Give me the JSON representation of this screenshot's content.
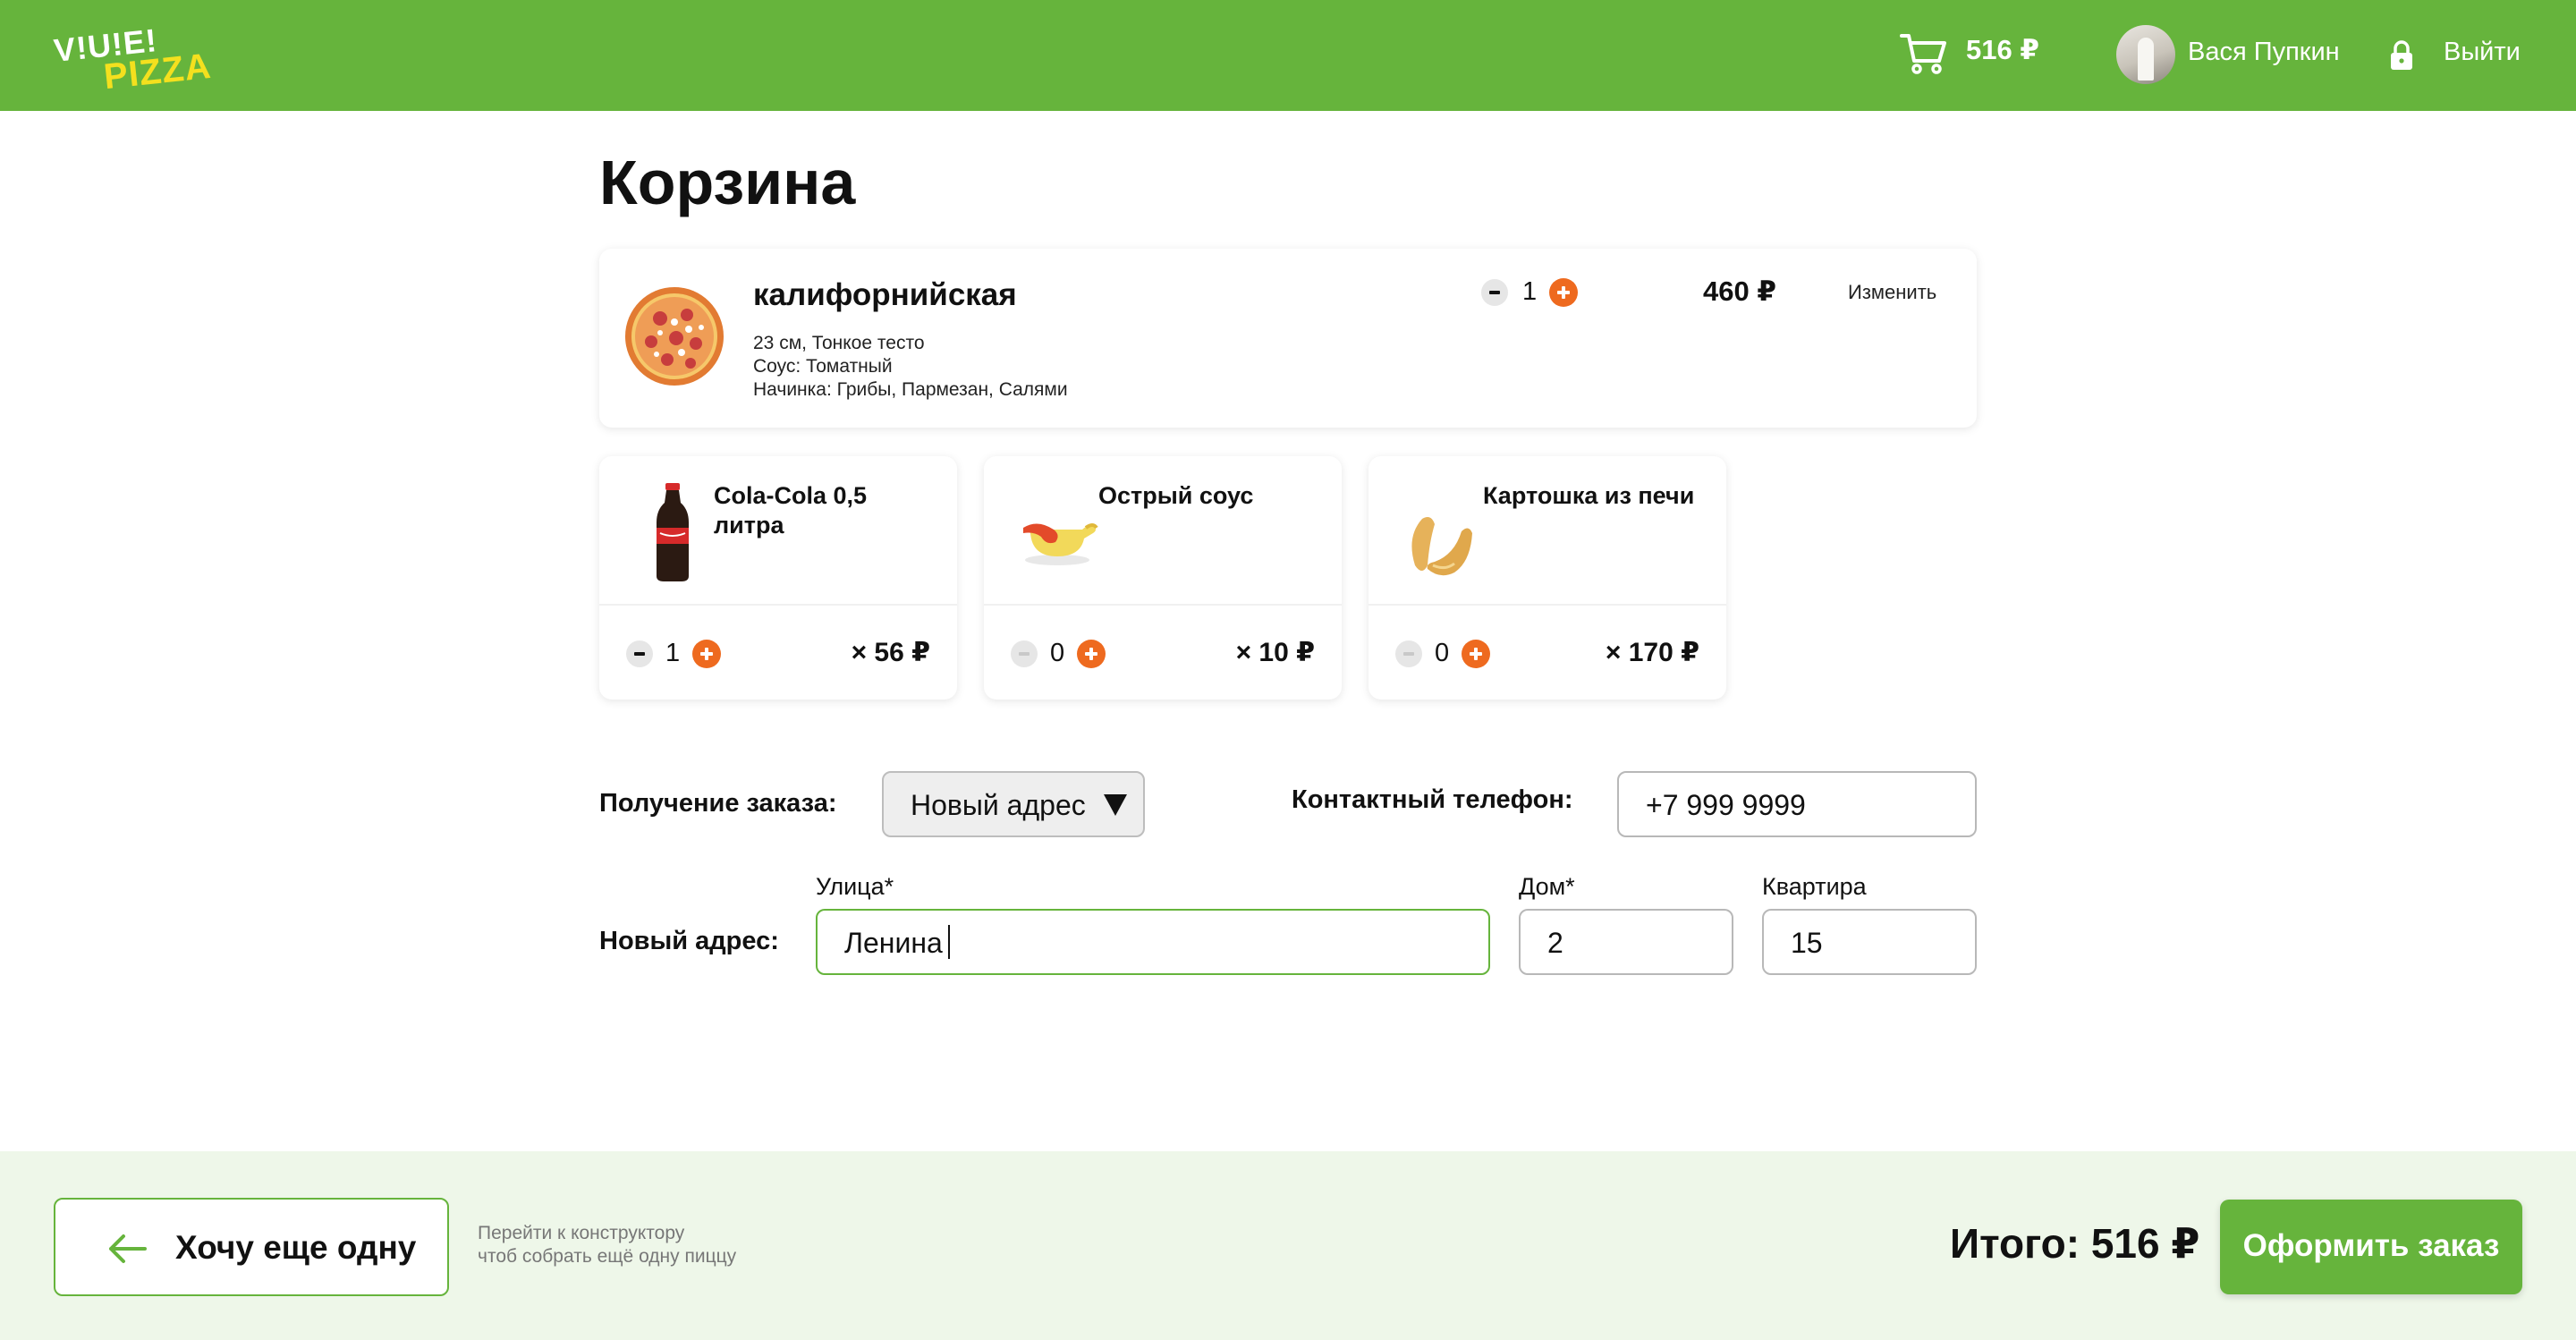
{
  "header": {
    "logo_top": "V!U!E!",
    "logo_bottom": "PIZZA",
    "cart_sum": "516 ₽",
    "user_name": "Вася Пупкин",
    "logout_label": "Выйти"
  },
  "page_title": "Корзина",
  "pizza": {
    "name": "калифорнийская",
    "size_dough": "23 см, Тонкое тесто",
    "sauce": "Соус: Томатный",
    "filling": "Начинка: Грибы, Пармезан, Салями",
    "quantity": "1",
    "price": "460 ₽",
    "edit_label": "Изменить"
  },
  "extras": [
    {
      "name": "Cola-Cola 0,5 литра",
      "quantity": "1",
      "price": "× 56 ₽",
      "minus_disabled": false
    },
    {
      "name": "Острый соус",
      "quantity": "0",
      "price": "× 10 ₽",
      "minus_disabled": true
    },
    {
      "name": "Картошка из печи",
      "quantity": "0",
      "price": "× 170 ₽",
      "minus_disabled": true
    }
  ],
  "form": {
    "delivery_label": "Получение заказа:",
    "delivery_value": "Новый адрес",
    "phone_label": "Контактный телефон:",
    "phone_value": "+7 999 9999",
    "address_label": "Новый адрес:",
    "street_label": "Улица*",
    "street_value": "Ленина",
    "house_label": "Дом*",
    "house_value": "2",
    "apartment_label": "Квартира",
    "apartment_value": "15"
  },
  "footer": {
    "back_label": "Хочу еще одну",
    "hint_line1": "Перейти к конструктору",
    "hint_line2": "чтоб собрать ещё одну пиццу",
    "total": "Итого: 516 ₽",
    "order_label": "Оформить заказ"
  },
  "colors": {
    "brand_green": "#66b43c",
    "accent_orange": "#ee6a1f",
    "logo_yellow": "#f4e01e",
    "footer_bg": "#eef7e9"
  },
  "icons": [
    "cart-icon",
    "avatar",
    "lock-icon",
    "minus-icon",
    "plus-icon",
    "dropdown-arrow-icon",
    "arrow-left-icon"
  ]
}
